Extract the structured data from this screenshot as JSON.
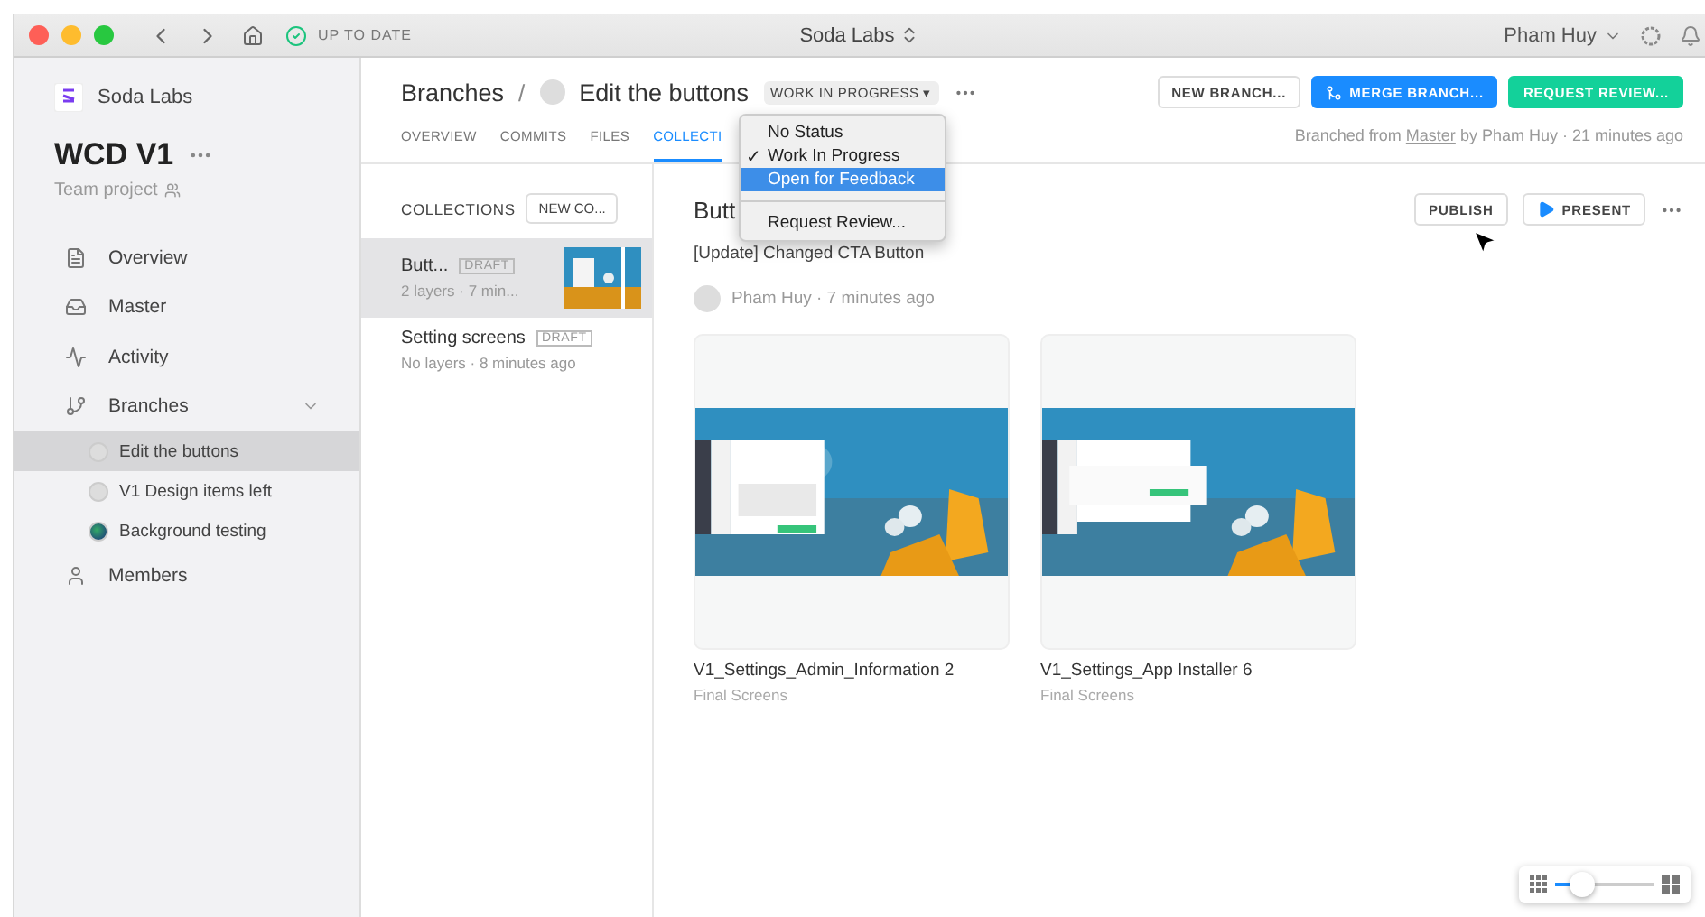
{
  "titlebar": {
    "sync_status": "UP TO DATE",
    "title": "Soda Labs",
    "user": "Pham Huy"
  },
  "sidebar": {
    "org": "Soda Labs",
    "project": "WCD V1",
    "project_type": "Team project",
    "items": [
      {
        "label": "Overview",
        "selected": false
      },
      {
        "label": "Master",
        "selected": false
      },
      {
        "label": "Activity",
        "selected": false
      },
      {
        "label": "Branches",
        "selected": false,
        "expanded": true,
        "children": [
          {
            "label": "Edit the buttons",
            "has_photo": false,
            "selected": true
          },
          {
            "label": "V1 Design items left",
            "has_photo": false,
            "selected": false
          },
          {
            "label": "Background testing",
            "has_photo": true,
            "selected": false
          }
        ]
      },
      {
        "label": "Members",
        "selected": false
      }
    ]
  },
  "header": {
    "crumb": "Branches",
    "separator": "/",
    "branch": "Edit the buttons",
    "status": "WORK IN PROGRESS ▾",
    "buttons": [
      {
        "label": "NEW BRANCH...",
        "kind": "plain"
      },
      {
        "label": "MERGE BRANCH...",
        "kind": "merge"
      },
      {
        "label": "REQUEST REVIEW...",
        "kind": "review"
      }
    ],
    "tabs": [
      {
        "label": "OVERVIEW",
        "selected": false
      },
      {
        "label": "COMMITS",
        "selected": false
      },
      {
        "label": "FILES",
        "selected": false
      },
      {
        "label": "COLLECTI",
        "selected": true
      }
    ],
    "branched_from": {
      "before": "Branched from",
      "link": "Master",
      "after": "by Pham Huy · 21 minutes ago"
    }
  },
  "status_menu": {
    "items": [
      {
        "label": "No Status",
        "checked": false,
        "selected": false
      },
      {
        "label": "Work In Progress",
        "checked": true,
        "selected": false
      },
      {
        "label": "Open for Feedback",
        "checked": false,
        "selected": true
      },
      {
        "label": "Request Review...",
        "checked": false,
        "selected": false
      }
    ],
    "check": "✓"
  },
  "collections": {
    "heading": "COLLECTIONS",
    "new_button": "NEW CO...",
    "items": [
      {
        "name": "Butt...",
        "badge": "DRAFT",
        "meta": "2 layers · 7 min...",
        "has_thumb": true,
        "selected": true
      },
      {
        "name": "Setting screens",
        "badge": "DRAFT",
        "meta": "No layers · 8 minutes ago",
        "has_thumb": false,
        "selected": false
      }
    ]
  },
  "detail": {
    "title": "Butt",
    "publish": "PUBLISH",
    "present": "PRESENT",
    "description": "[Update] Changed CTA Button",
    "author": "Pham Huy · 7 minutes ago",
    "artboards": [
      {
        "name": "V1_Settings_Admin_Information 2",
        "section": "Final Screens"
      },
      {
        "name": "V1_Settings_App Installer 6",
        "section": "Final Screens"
      }
    ]
  },
  "zoom": {
    "level": 0.28
  }
}
